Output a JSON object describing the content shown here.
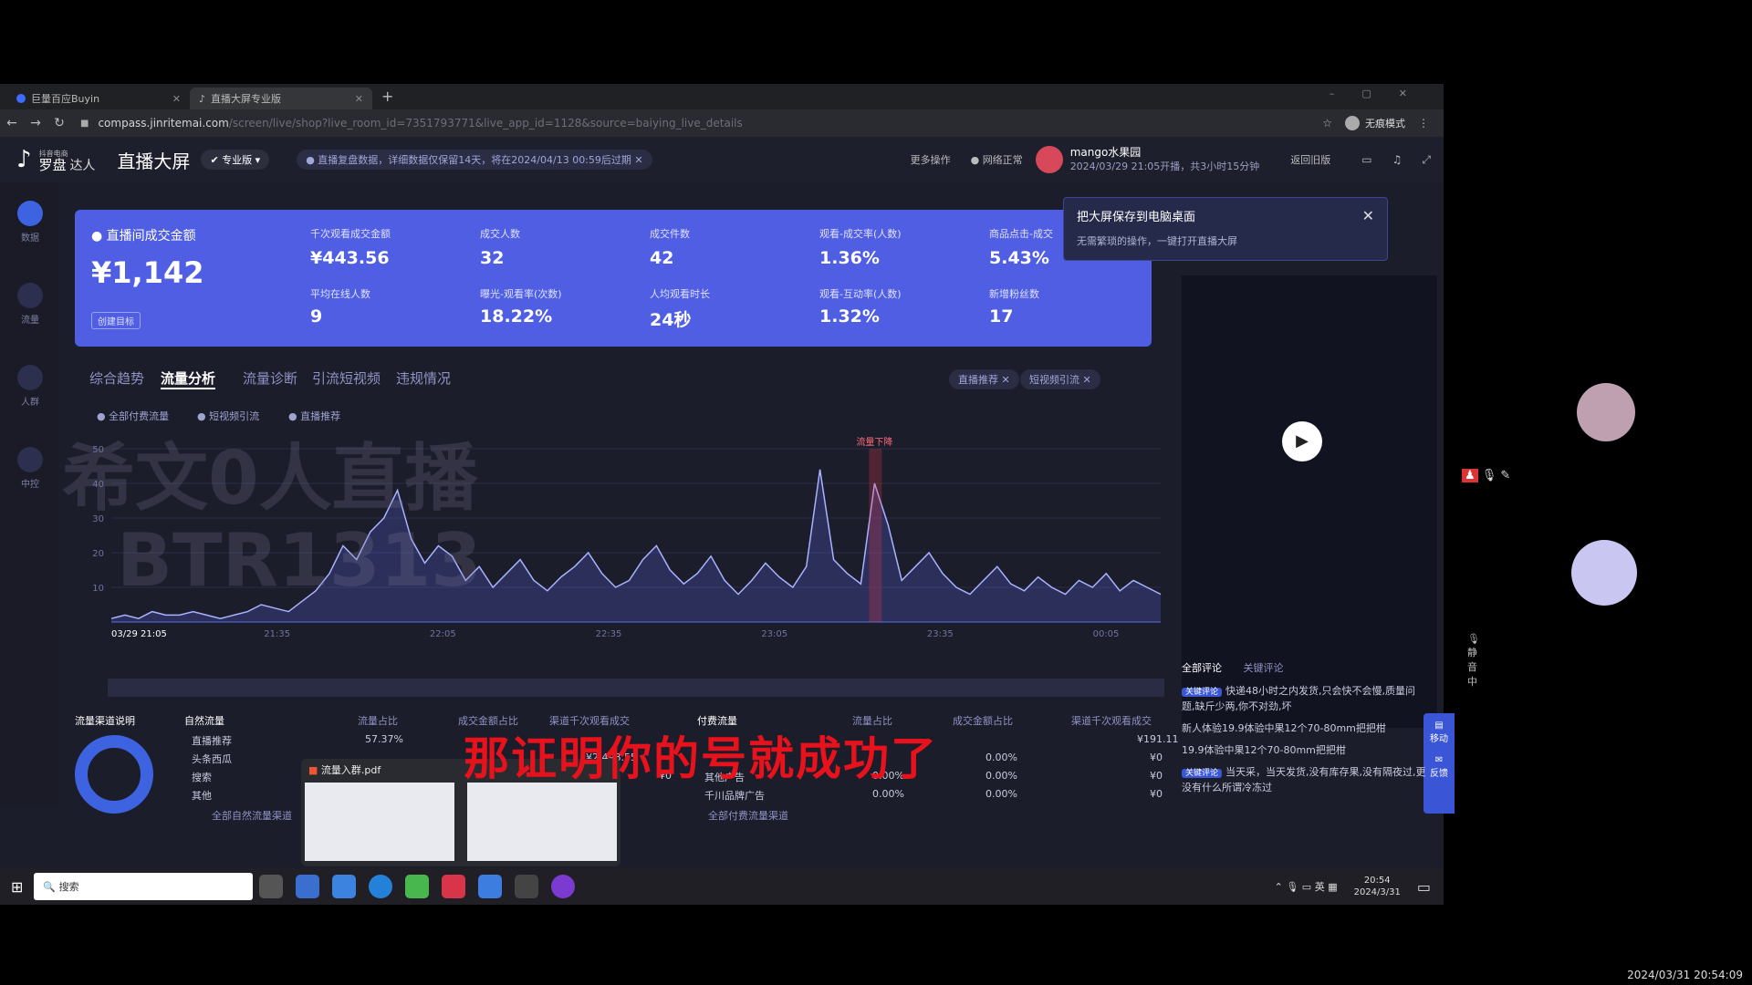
{
  "browser": {
    "tabs": [
      {
        "label": "巨量百应Buyin"
      },
      {
        "label": "直播大屏专业版"
      }
    ],
    "url": "compass.jinritemai.com",
    "url_rest": "/screen/live/shop?live_room_id=7351793771&live_app_id=1128&source=baiying_live_details",
    "profile": "无痕模式"
  },
  "app": {
    "brand_small": "抖音电商",
    "brand": "罗盘",
    "brand_role": "达人",
    "title": "直播大屏",
    "edition": "专业版",
    "notice": "直播复盘数据，详细数据仅保留14天，将在2024/04/13 00:59后过期",
    "more_actions": "更多操作",
    "network": "网络正常",
    "streamer": "mango水果园",
    "stream_info": "2024/03/29 21:05开播，共3小时15分钟",
    "back_old": "返回旧版"
  },
  "sidebar": [
    {
      "label": "数据"
    },
    {
      "label": "流量"
    },
    {
      "label": "人群"
    },
    {
      "label": "中控"
    }
  ],
  "metrics": {
    "gmv_label": "直播间成交金额",
    "gmv_value": "¥1,142",
    "target_btn": "创建目标",
    "items": [
      {
        "label": "千次观看成交金额",
        "value": "¥443.56"
      },
      {
        "label": "成交人数",
        "value": "32"
      },
      {
        "label": "成交件数",
        "value": "42"
      },
      {
        "label": "观看-成交率(人数)",
        "value": "1.36%"
      },
      {
        "label": "商品点击-成交",
        "value": "5.43%"
      },
      {
        "label": "平均在线人数",
        "value": "9"
      },
      {
        "label": "曝光-观看率(次数)",
        "value": "18.22%"
      },
      {
        "label": "人均观看时长",
        "value": "24秒"
      },
      {
        "label": "观看-互动率(人数)",
        "value": "1.32%"
      },
      {
        "label": "新增粉丝数",
        "value": "17"
      }
    ]
  },
  "popup": {
    "title": "把大屏保存到电脑桌面",
    "desc": "无需繁琐的操作，一键打开直播大屏"
  },
  "content_tabs": [
    "综合趋势",
    "流量分析",
    "流量诊断",
    "引流短视频",
    "违规情况"
  ],
  "filters": [
    "直播推荐",
    "短视频引流"
  ],
  "legend": [
    "全部付费流量",
    "短视频引流",
    "直播推荐"
  ],
  "chart_data": {
    "type": "line",
    "x_ticks": [
      "03/29 21:05",
      "21:35",
      "22:05",
      "22:35",
      "23:05",
      "23:35",
      "00:05"
    ],
    "y_ticks": [
      "10",
      "20",
      "30",
      "40",
      "50"
    ],
    "annotation": "流量下降",
    "series": [
      {
        "values": [
          1,
          2,
          1,
          3,
          2,
          2,
          3,
          2,
          1,
          2,
          3,
          5,
          4,
          3,
          6,
          9,
          14,
          22,
          18,
          26,
          30,
          38,
          24,
          17,
          22,
          19,
          12,
          16,
          10,
          14,
          18,
          12,
          9,
          13,
          16,
          20,
          14,
          10,
          12,
          18,
          22,
          15,
          11,
          14,
          19,
          12,
          8,
          12,
          17,
          13,
          10,
          16,
          44,
          18,
          14,
          11,
          40,
          28,
          12,
          16,
          20,
          14,
          10,
          8,
          12,
          16,
          11,
          9,
          13,
          10,
          8,
          12,
          10,
          14,
          9,
          12,
          10,
          8
        ]
      }
    ]
  },
  "bottom": {
    "channel_title": "流量渠道说明",
    "natural_title": "自然流量",
    "natural_headers": [
      "流量占比",
      "成交金额占比",
      "渠道千次观看成交"
    ],
    "natural_rows": [
      {
        "name": "直播推荐",
        "share": "57.37%"
      },
      {
        "name": "头条西瓜"
      },
      {
        "name": "搜索"
      },
      {
        "name": "其他"
      }
    ],
    "natural_link": "全部自然流量渠道",
    "paid_title": "付费流量",
    "paid_headers": [
      "流量占比",
      "成交金额占比",
      "渠道千次观看成交"
    ],
    "paid_rows": [
      {
        "name": "",
        "share": "",
        "gmv": "",
        "v": "¥191.11"
      },
      {
        "name": "",
        "share": "0.00%",
        "gmv": "0.00%",
        "v": "¥0"
      },
      {
        "name": "其他广告",
        "share": "0.00%",
        "gmv": "0.00%",
        "v": "¥0"
      },
      {
        "name": "千川品牌广告",
        "share": "0.00%",
        "gmv": "0.00%",
        "v": "¥0"
      }
    ],
    "paid_link": "全部付费流量渠道",
    "mid_values": [
      "¥2,498.55",
      "¥0"
    ],
    "file_name": "流量入群.pdf"
  },
  "comments": {
    "tabs": [
      "全部评论",
      "关键评论"
    ],
    "items": [
      {
        "tag": "关键评论",
        "text": "快递48小时之内发货,只会快不会慢,质量问题,缺斤少两,你不对劲,坏"
      },
      {
        "tag": "",
        "text": "新人体验19.9体验中果12个70-80mm把把柑"
      },
      {
        "tag": "",
        "text": "19.9体验中果12个70-80mm把把柑"
      },
      {
        "tag": "关键评论",
        "text": "当天采，当天发货,没有库存果,没有隔夜过,更没有什么所谓冷冻过"
      }
    ],
    "mic": "静音中",
    "side_move": "移动",
    "side_feedback": "反馈"
  },
  "overlay": {
    "subtitle": "那证明你的号就成功了",
    "watermark_1": "希文0人直播",
    "watermark_2": "BTR1313"
  },
  "taskbar": {
    "search": "搜索",
    "time": "20:54",
    "date": "2024/3/31",
    "lang": "英"
  },
  "timestamp": "2024/03/31 20:54:09"
}
